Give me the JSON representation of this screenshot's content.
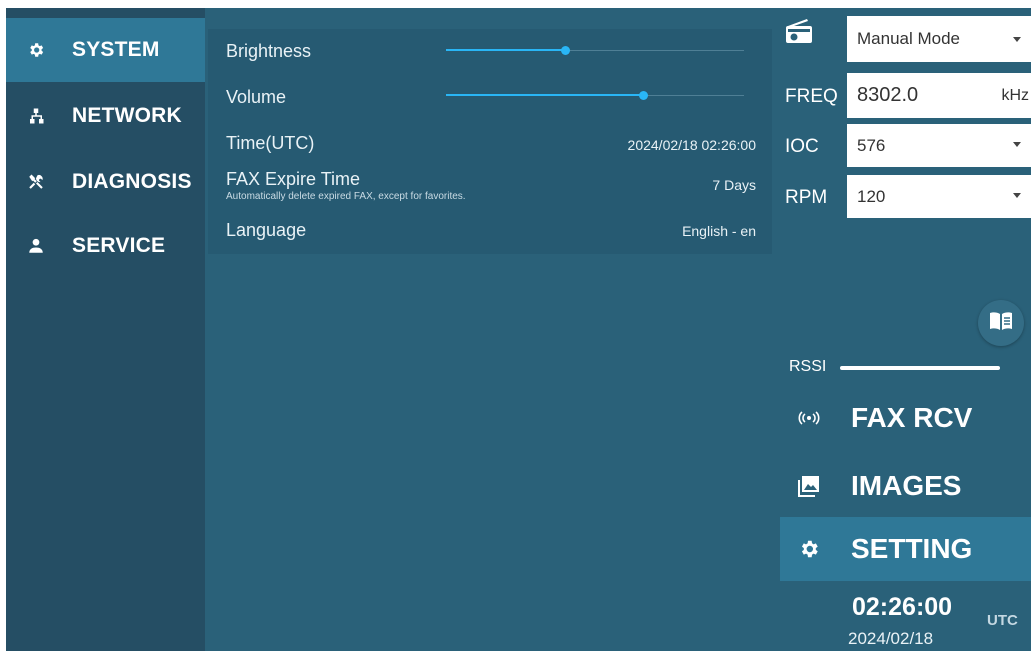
{
  "sidebar": {
    "items": [
      {
        "label": "SYSTEM",
        "icon": "gear-icon",
        "active": true
      },
      {
        "label": "NETWORK",
        "icon": "network-icon",
        "active": false
      },
      {
        "label": "DIAGNOSIS",
        "icon": "tools-icon",
        "active": false
      },
      {
        "label": "SERVICE",
        "icon": "person-icon",
        "active": false
      }
    ]
  },
  "settings": {
    "brightness": {
      "label": "Brightness",
      "level": 0.4
    },
    "volume": {
      "label": "Volume",
      "level": 0.66
    },
    "time": {
      "label": "Time(UTC)",
      "value": "2024/02/18 02:26:00"
    },
    "fax_expire": {
      "label": "FAX Expire Time",
      "sub": "Automatically delete expired FAX, except for favorites.",
      "value": "7 Days"
    },
    "language": {
      "label": "Language",
      "value": "English - en"
    }
  },
  "radio": {
    "mode": "Manual Mode",
    "freq_label": "FREQ",
    "freq_value": "8302.0",
    "freq_unit": "kHz",
    "ioc_label": "IOC",
    "ioc_value": "576",
    "rpm_label": "RPM",
    "rpm_value": "120",
    "rssi_label": "RSSI"
  },
  "main_nav": [
    {
      "label": "FAX RCV",
      "icon": "broadcast-icon",
      "active": false
    },
    {
      "label": "IMAGES",
      "icon": "images-icon",
      "active": false
    },
    {
      "label": "SETTING",
      "icon": "gear-icon",
      "active": true
    }
  ],
  "clock": {
    "time": "02:26:00",
    "tz": "UTC",
    "date": "2024/02/18"
  },
  "colors": {
    "accent": "#29b6f6",
    "background": "#2a6179",
    "sidebar": "#254e64",
    "active": "#2f7897"
  }
}
